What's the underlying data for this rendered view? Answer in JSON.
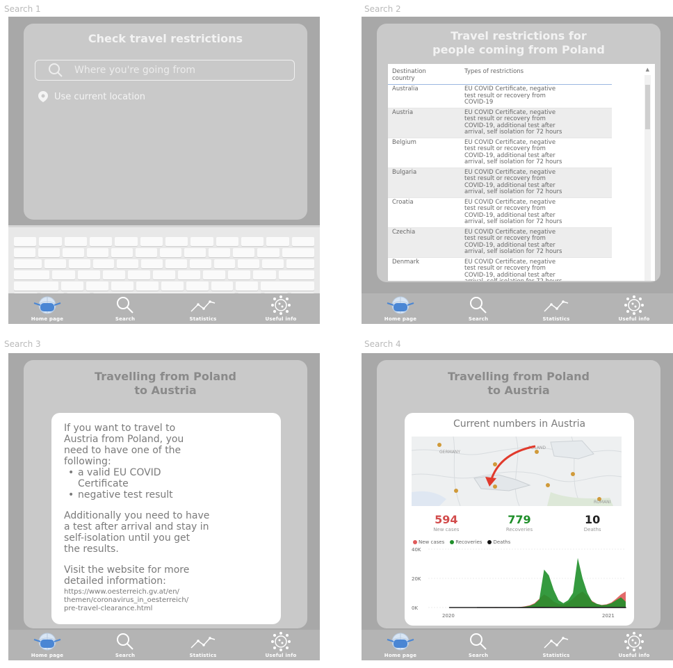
{
  "frames": [
    {
      "label": "Search 1"
    },
    {
      "label": "Search 2"
    },
    {
      "label": "Search 3"
    },
    {
      "label": "Search 4"
    }
  ],
  "nav": {
    "home": "Home page",
    "search": "Search",
    "statistics": "Statistics",
    "useful": "Useful info"
  },
  "search1": {
    "title": "Check travel restrictions",
    "placeholder": "Where you're going from",
    "use_location": "Use current location"
  },
  "search2": {
    "title_line1": "Travel restrictions for",
    "title_line2": "people coming from Poland",
    "col1_line1": "Destination",
    "col1_line2": "country",
    "col2": "Types of restrictions",
    "rows": [
      {
        "country": "Australia",
        "restrictions": [
          "EU COVID Certificate, negative",
          "test result or recovery from",
          "COVID-19"
        ]
      },
      {
        "country": "Austria",
        "restrictions": [
          "EU COVID Certificate, negative",
          "test result or recovery from",
          "COVID-19, additional test after",
          "arrival, self isolation for 72 hours"
        ]
      },
      {
        "country": "Belgium",
        "restrictions": [
          "EU COVID Certificate, negative",
          "test result or recovery from",
          "COVID-19, additional test after",
          "arrival, self isolation for 72 hours"
        ]
      },
      {
        "country": "Bulgaria",
        "restrictions": [
          "EU COVID Certificate, negative",
          "test result or recovery from",
          "COVID-19, additional test after",
          "arrival, self isolation for 72 hours"
        ]
      },
      {
        "country": "Croatia",
        "restrictions": [
          "EU COVID Certificate, negative",
          "test result or recovery from",
          "COVID-19, additional test after",
          "arrival, self isolation for 72 hours"
        ]
      },
      {
        "country": "Czechia",
        "restrictions": [
          "EU COVID Certificate, negative",
          "test result or recovery from",
          "COVID-19, additional test after",
          "arrival, self isolation for 72 hours"
        ]
      },
      {
        "country": "Denmark",
        "restrictions": [
          "EU COVID Certificate, negative",
          "test result or recovery from",
          "COVID-19, additional test after",
          "arrival, self isolation for 72 hours"
        ]
      }
    ]
  },
  "search3": {
    "title_line1": "Travelling from Poland",
    "title_line2": "to Austria",
    "intro_lines": [
      "If you want to travel to",
      "Austria from Poland, you",
      "need to have one of the",
      "following:"
    ],
    "bullets": [
      [
        "a valid EU COVID",
        "Certificate"
      ],
      [
        "negative test result"
      ]
    ],
    "additional_lines": [
      "Additionally you need to have",
      "a test after arrival and stay in",
      "self-isolation until you get",
      "the results."
    ],
    "visit_lines": [
      "Visit the website for more",
      "detailed information:"
    ],
    "link_lines": [
      "https://www.oesterreich.gv.at/en/",
      "themen/coronavirus_in_oesterreich/",
      "pre-travel-clearance.html"
    ]
  },
  "search4": {
    "title_line1": "Travelling from Poland",
    "title_line2": "to Austria",
    "stats_title": "Current numbers in Austria",
    "map_labels": {
      "poland": "POLAND",
      "germany": "GERMANY",
      "romania": "ROMANI"
    },
    "new_cases": "594",
    "new_cases_label": "New cases",
    "recoveries": "779",
    "recoveries_label": "Recoveries",
    "deaths": "10",
    "deaths_label": "Deaths",
    "colors": {
      "new_cases": "#e05a5a",
      "recoveries": "#1f8f2a",
      "deaths": "#111111"
    },
    "chart_data": {
      "type": "area",
      "legend": [
        "New cases",
        "Recoveries",
        "Deaths"
      ],
      "ylim": [
        0,
        40000
      ],
      "yticks": [
        "40K",
        "20K",
        "0K"
      ],
      "xticks": [
        "2020",
        "2021"
      ],
      "series": [
        {
          "name": "New cases",
          "values": [
            0,
            0,
            100,
            200,
            300,
            200,
            100,
            100,
            200,
            400,
            800,
            1500,
            3000,
            6000,
            9000,
            7000,
            4000,
            2500,
            2000,
            3500,
            6000,
            9000,
            11000,
            8000,
            4500,
            2500,
            1800,
            2200,
            3500,
            6000,
            9000,
            11000
          ]
        },
        {
          "name": "Recoveries",
          "values": [
            0,
            0,
            50,
            150,
            250,
            200,
            100,
            80,
            150,
            300,
            600,
            1200,
            2500,
            5500,
            26000,
            22000,
            12000,
            5000,
            3000,
            5000,
            10000,
            34000,
            20000,
            10000,
            4000,
            2500,
            1600,
            1900,
            3000,
            5000,
            7000,
            4000
          ]
        },
        {
          "name": "Deaths",
          "values": [
            0,
            0,
            0,
            10,
            20,
            10,
            5,
            5,
            10,
            20,
            40,
            80,
            120,
            180,
            200,
            160,
            100,
            60,
            40,
            60,
            90,
            120,
            100,
            70,
            40,
            25,
            18,
            20,
            30,
            40,
            50,
            40
          ]
        }
      ]
    }
  }
}
